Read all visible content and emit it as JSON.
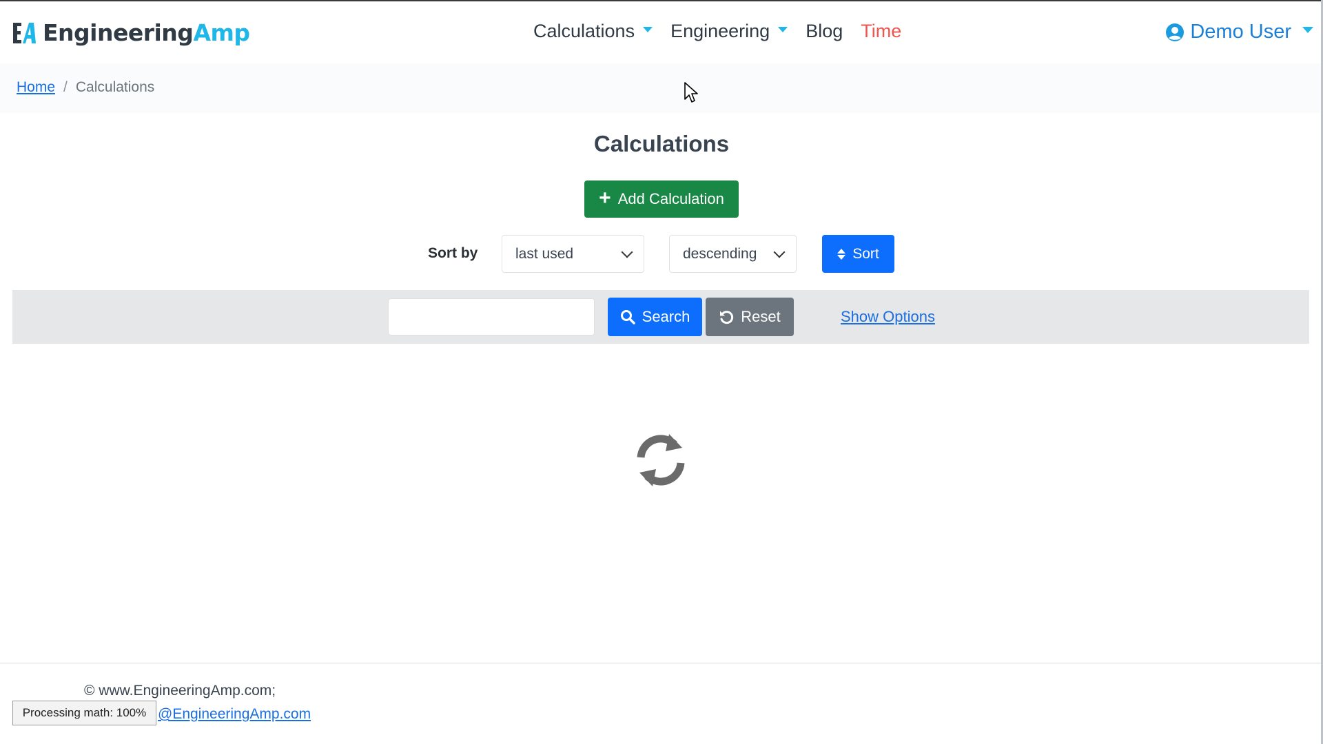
{
  "brand": {
    "logo_text": "EA",
    "name_part1": "Engineering",
    "name_part2": "Amp",
    "accent": "#1fb6e8"
  },
  "nav": {
    "items": [
      {
        "label": "Calculations",
        "has_dropdown": true
      },
      {
        "label": "Engineering",
        "has_dropdown": true
      },
      {
        "label": "Blog",
        "has_dropdown": false
      },
      {
        "label": "Time",
        "has_dropdown": false,
        "color": "#f0544f"
      }
    ],
    "user": {
      "label": "Demo User",
      "icon": "user-circle-icon"
    }
  },
  "breadcrumb": {
    "home": "Home",
    "separator": "/",
    "current": "Calculations"
  },
  "page": {
    "title": "Calculations"
  },
  "actions": {
    "add_label": "Add Calculation",
    "add_icon": "plus-icon"
  },
  "sort": {
    "label": "Sort by",
    "field_value": "last used",
    "order_value": "descending",
    "button_label": "Sort",
    "button_icon": "sort-icon"
  },
  "search": {
    "input_value": "",
    "placeholder": "",
    "search_label": "Search",
    "search_icon": "magnifier-icon",
    "reset_label": "Reset",
    "reset_icon": "undo-icon",
    "options_link": "Show Options"
  },
  "loading": {
    "icon": "refresh-spinner-icon"
  },
  "footer": {
    "copyright": "© www.EngineeringAmp.com;",
    "email_visible": "@EngineeringAmp.com",
    "processing": "Processing math: 100%"
  },
  "colors": {
    "primary": "#0d6efd",
    "success": "#198745",
    "secondary": "#6c757d",
    "link": "#1a6fe0"
  }
}
